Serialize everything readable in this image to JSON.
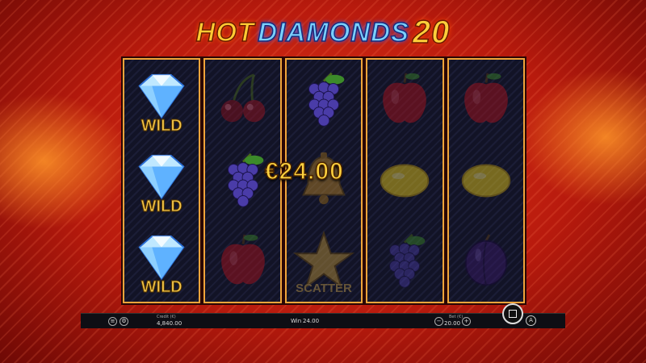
{
  "title": {
    "part1": "HOT",
    "part2": "DIAMONDS",
    "part3": "20"
  },
  "win_overlay": "€24.00",
  "reels": [
    [
      {
        "icon": "diamond-wild",
        "label": "WILD",
        "dim": false
      },
      {
        "icon": "diamond-wild",
        "label": "WILD",
        "dim": false
      },
      {
        "icon": "diamond-wild",
        "label": "WILD",
        "dim": false
      }
    ],
    [
      {
        "icon": "cherry",
        "dim": true
      },
      {
        "icon": "grapes",
        "dim": false
      },
      {
        "icon": "apple",
        "dim": true
      }
    ],
    [
      {
        "icon": "grapes",
        "dim": false
      },
      {
        "icon": "bell",
        "dim": true
      },
      {
        "icon": "star-scatter",
        "label": "SCATTER",
        "dim": true
      }
    ],
    [
      {
        "icon": "apple",
        "dim": true
      },
      {
        "icon": "lemon",
        "dim": true
      },
      {
        "icon": "grapes",
        "dim": true
      }
    ],
    [
      {
        "icon": "apple",
        "dim": true
      },
      {
        "icon": "lemon",
        "dim": true
      },
      {
        "icon": "plum",
        "dim": true
      }
    ]
  ],
  "status_bar": {
    "credit_label": "Credit (€)",
    "credit_value": "4,840.00",
    "win_label": "Win",
    "win_value": "24.00",
    "bet_label": "Bet (€)",
    "bet_value": "20.00",
    "bet_minus": "−",
    "bet_plus": "+",
    "menu_icon": "menu-icon",
    "settings_icon": "settings-icon"
  },
  "autoplay_label": "A",
  "colors": {
    "accent": "#f0a43a",
    "win_text": "#ffd23f",
    "background": "#c4200f"
  }
}
